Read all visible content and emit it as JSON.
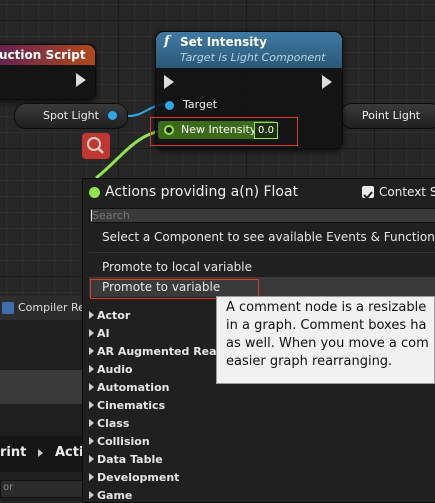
{
  "graph": {
    "construction_node": {
      "title": "uction Script"
    },
    "spot_light_pill": {
      "label": "Spot Light"
    },
    "point_light_pill": {
      "label": "Point Light"
    },
    "set_intensity_node": {
      "function_glyph": "f",
      "title": "Set Intensity",
      "subtitle": "Target is Light Component",
      "target_label": "Target",
      "new_intensity_label": "New Intensity",
      "new_intensity_value": "0.0"
    },
    "search_icon": "search-icon"
  },
  "left_panel": {
    "compiler_tab": "Compiler Re",
    "breadcrumb_left": "rint",
    "breadcrumb_right": "Acti",
    "search_fragment": "or"
  },
  "actions_menu": {
    "title": "Actions providing a(n) Float",
    "context_sensitive_label": "Context Se",
    "context_sensitive_checked": true,
    "search_placeholder": "Search",
    "info_line": "Select a Component to see available Events & Functions",
    "promote_local": "Promote to local variable",
    "promote_variable": "Promote to variable",
    "categories": [
      "Actor",
      "AI",
      "AR Augmented Reality",
      "Audio",
      "Automation",
      "Cinematics",
      "Class",
      "Collision",
      "Data Table",
      "Development",
      "Game"
    ]
  },
  "tooltip": {
    "lines": [
      "A comment node is a resizable",
      "in a graph. Comment boxes ha",
      "as well. When you move a com",
      "easier graph rearranging."
    ]
  },
  "colors": {
    "function_header": "#3b6f96",
    "float_pin": "#8fe54a",
    "object_pin": "#2aa8e8",
    "highlight": "#d93a2b"
  }
}
